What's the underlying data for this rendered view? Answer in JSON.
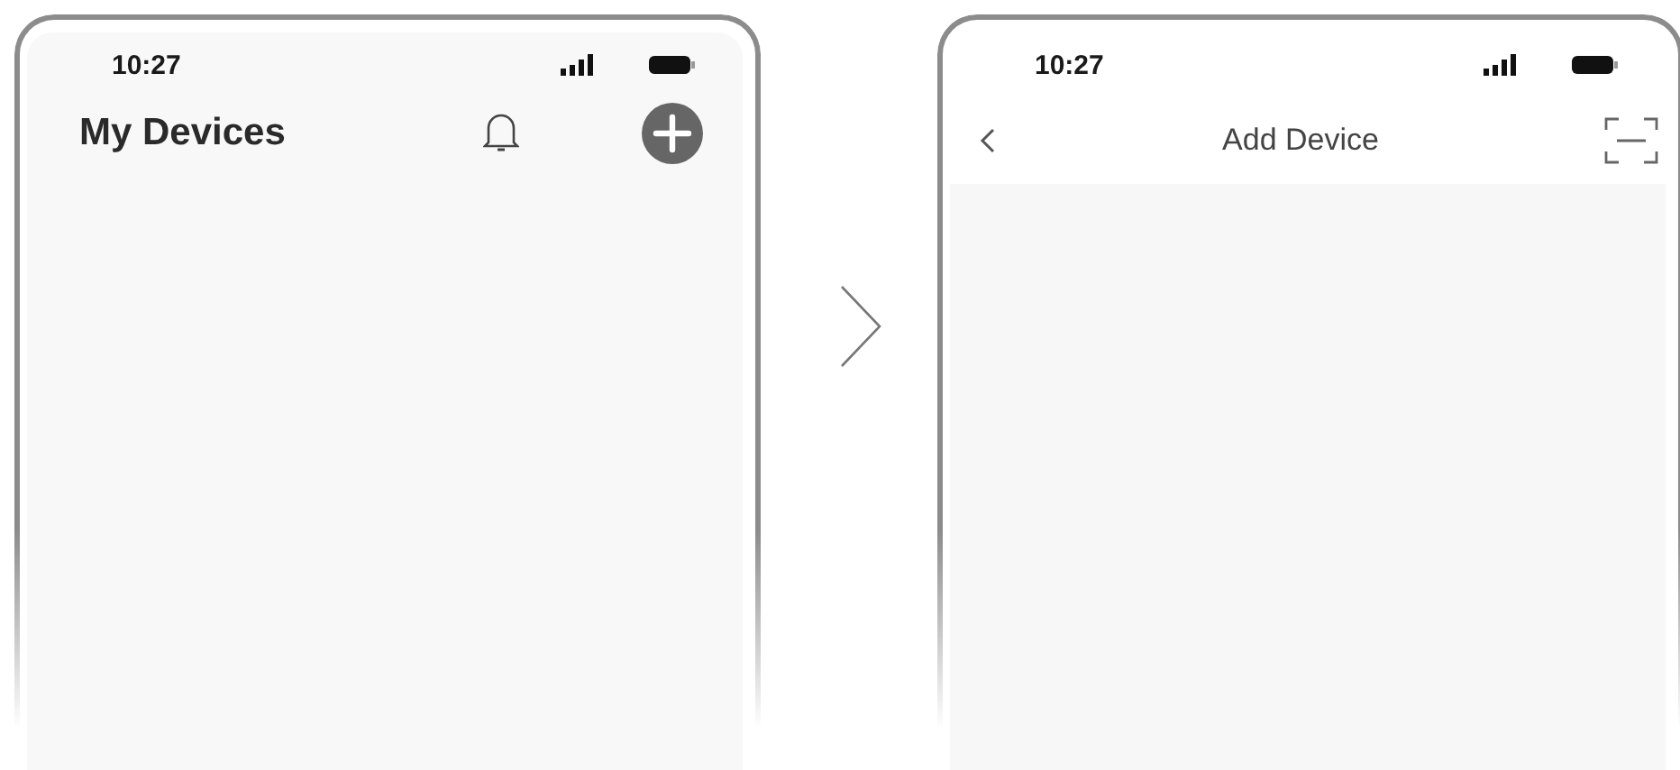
{
  "screens": [
    {
      "kind": "list",
      "status_bar": {
        "time": "10:27"
      },
      "title": "My Devices"
    },
    {
      "kind": "add",
      "status_bar": {
        "time": "10:27"
      },
      "title": "Add Device"
    }
  ]
}
